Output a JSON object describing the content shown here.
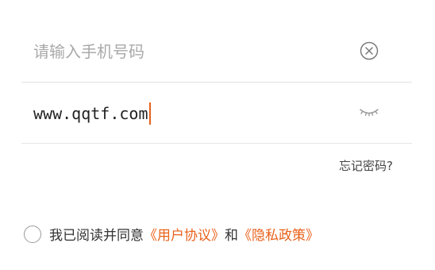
{
  "phone": {
    "placeholder": "请输入手机号码",
    "value": "",
    "clear_icon": "circle-x-icon"
  },
  "password": {
    "value": "www.qqtf.com",
    "visibility_icon": "closed-eye-icon"
  },
  "forgot_password": "忘记密码?",
  "agreement": {
    "checked": false,
    "prefix": "我已阅读并同意",
    "user_agreement": "《用户协议》",
    "conjunction": "和",
    "privacy_policy": "《隐私政策》"
  },
  "colors": {
    "accent": "#e8611a",
    "placeholder": "#a9a9a9",
    "divider": "#e3e3e3",
    "text": "#333333"
  }
}
